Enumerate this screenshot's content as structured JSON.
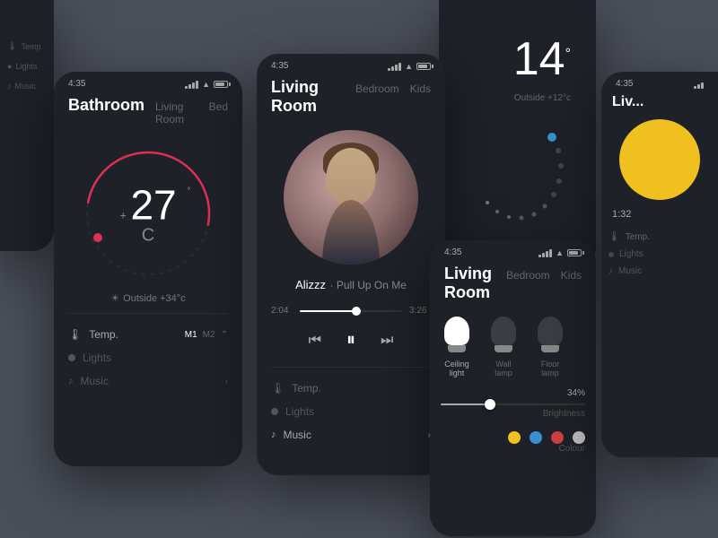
{
  "scene": {
    "background": "#4a4f5a"
  },
  "phone_main": {
    "status": {
      "time": "4:35"
    },
    "tabs": [
      "Bathroom",
      "Living Room",
      "Bed"
    ],
    "active_tab": "Bathroom",
    "temperature": {
      "value": "27",
      "unit": "C",
      "prefix": "+",
      "degree_symbol": "°"
    },
    "outside": "Outside +34°c",
    "sections": {
      "temp_label": "Temp.",
      "temp_tabs": [
        "M1",
        "M2"
      ],
      "lights_label": "Lights",
      "music_label": "Music"
    }
  },
  "phone_music": {
    "status": {
      "time": "4:35"
    },
    "tabs": [
      "Living Room",
      "Bedroom",
      "Kids"
    ],
    "active_tab": "Living Room",
    "track": {
      "artist": "Alizzz",
      "name": "Pull Up On Me"
    },
    "time_current": "2:04",
    "time_total": "3:26",
    "progress_percent": 55,
    "sections": {
      "temp_label": "Temp.",
      "lights_label": "Lights",
      "music_label": "Music"
    }
  },
  "phone_temp_right": {
    "temperature": "14",
    "degree": "°",
    "outside": "Outside +12°c"
  },
  "phone_lights": {
    "status": {
      "time": "4:35"
    },
    "tabs": [
      "Living Room",
      "Bedroom",
      "Kids"
    ],
    "active_tab": "Living Room",
    "bulbs": [
      {
        "label": "Ceiling\nlight",
        "active": true
      },
      {
        "label": "Wall\nlamp",
        "active": false
      },
      {
        "label": "Floor\nlamp",
        "active": false
      }
    ],
    "brightness": {
      "value": "34",
      "unit": "%",
      "label": "Brightness",
      "percent": 34
    },
    "colour": {
      "label": "Colour",
      "dots": [
        "#f0c020",
        "#3a8fd0",
        "#d04040",
        "#c0c0c0"
      ]
    }
  },
  "phone_far_right": {
    "time": "4:35",
    "title": "Liv...",
    "mini_time": "1:32"
  },
  "icons": {
    "thermometer": "🌡",
    "lightbulb": "💡",
    "music_note": "♪",
    "sun": "☀",
    "prev": "⏮",
    "play_pause": "⏸",
    "next": "⏭"
  }
}
